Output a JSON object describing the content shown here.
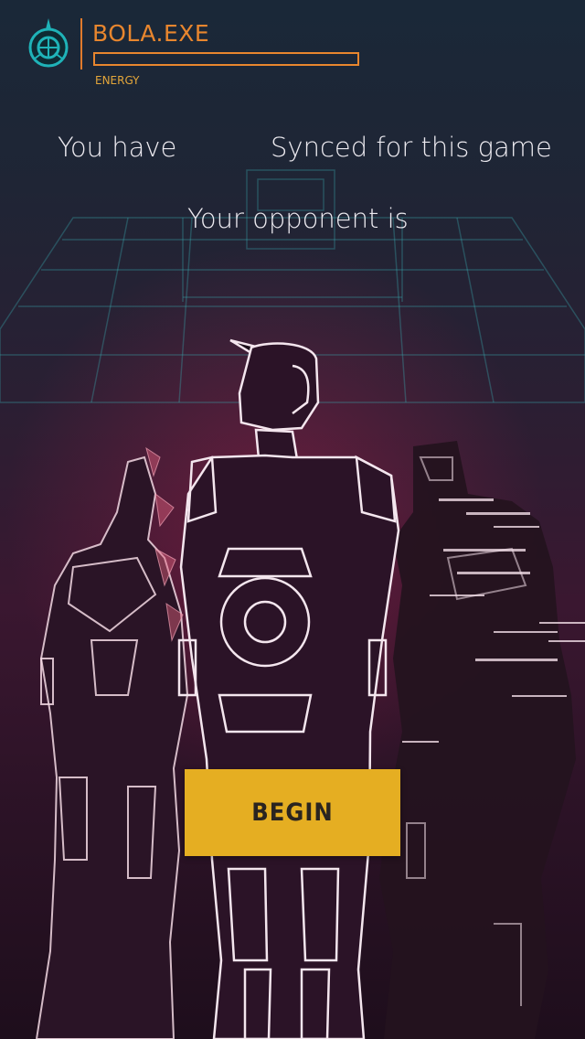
{
  "header": {
    "bot_name": "BOLA.EXE",
    "energy_label": "ENERGY",
    "energy_level": 0,
    "emblem_icon": "robot-crest-icon"
  },
  "sync": {
    "you_have_text": "You have",
    "synced_text": "Synced for this game",
    "opponent_text": "Your opponent is"
  },
  "actions": {
    "begin_label": "BEGIN"
  },
  "colors": {
    "accent_orange": "#e8862e",
    "button_yellow": "#e5ae22",
    "emblem_teal": "#1fb3b8",
    "grid_teal": "#3aa8b0",
    "robot_outline": "#f2e6ee"
  }
}
